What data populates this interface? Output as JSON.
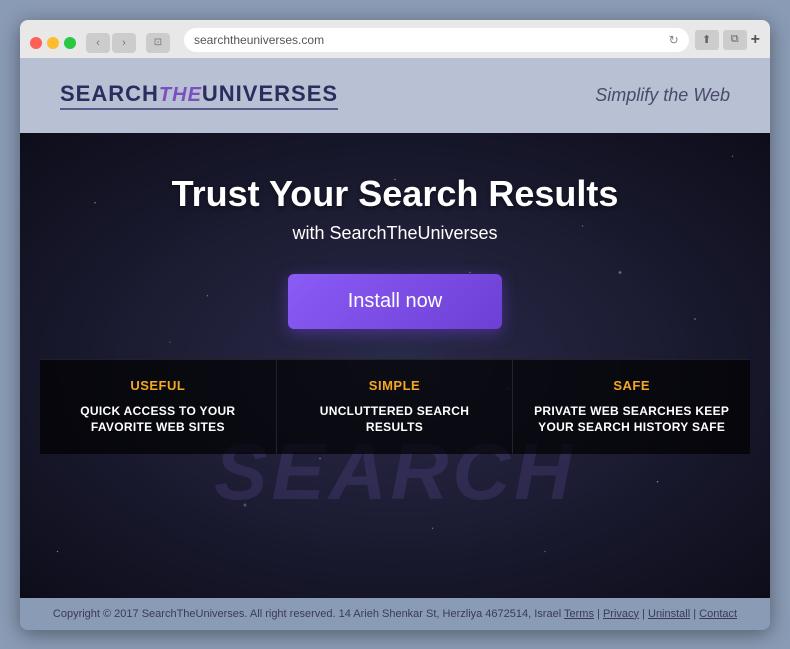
{
  "browser": {
    "address": "searchtheuniverses.com",
    "nav_back": "‹",
    "nav_forward": "›",
    "new_tab_label": "+",
    "share_icon": "⬆",
    "duplicate_icon": "⧉"
  },
  "header": {
    "logo_search": "SEARCH",
    "logo_the": "the",
    "logo_universes": "UNIVERSES",
    "tagline": "Simplify the Web"
  },
  "hero": {
    "title": "Trust Your Search Results",
    "subtitle": "with SearchTheUniverses",
    "install_button": "Install now",
    "watermark": "SEARCH"
  },
  "features": [
    {
      "label": "USEFUL",
      "label_class": "useful",
      "description": "QUICK ACCESS TO YOUR FAVORITE WEB SITES"
    },
    {
      "label": "SIMPLE",
      "label_class": "simple",
      "description": "UNCLUTTERED SEARCH RESULTS"
    },
    {
      "label": "SAFE",
      "label_class": "safe",
      "description": "PRIVATE WEB SEARCHES KEEP YOUR SEARCH HISTORY SAFE"
    }
  ],
  "footer": {
    "copyright": "Copyright © 2017 SearchTheUniverses. All right reserved. 14 Arieh Shenkar St, Herzliya 4672514, Israel",
    "links": [
      "Terms",
      "Privacy",
      "Uninstall",
      "Contact"
    ]
  }
}
